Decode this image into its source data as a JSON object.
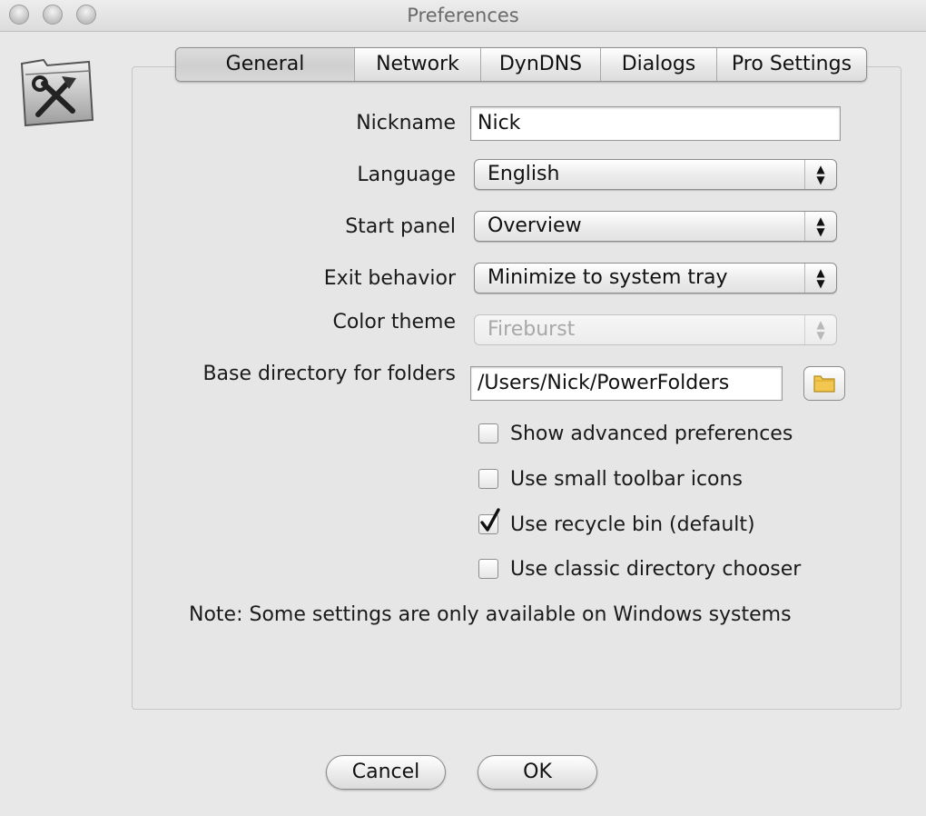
{
  "window": {
    "title": "Preferences"
  },
  "tabs": [
    {
      "label": "General",
      "active": true
    },
    {
      "label": "Network",
      "active": false
    },
    {
      "label": "DynDNS",
      "active": false
    },
    {
      "label": "Dialogs",
      "active": false
    },
    {
      "label": "Pro Settings",
      "active": false
    }
  ],
  "form": {
    "nickname": {
      "label": "Nickname",
      "value": "Nick"
    },
    "language": {
      "label": "Language",
      "value": "English"
    },
    "start_panel": {
      "label": "Start panel",
      "value": "Overview"
    },
    "exit_behavior": {
      "label": "Exit behavior",
      "value": "Minimize to system tray"
    },
    "color_theme": {
      "label": "Color theme",
      "value": "Fireburst",
      "disabled": true
    },
    "base_directory": {
      "label": "Base directory for folders",
      "value": "/Users/Nick/PowerFolders"
    }
  },
  "checkboxes": [
    {
      "label": "Show advanced preferences",
      "checked": false
    },
    {
      "label": "Use small toolbar icons",
      "checked": false
    },
    {
      "label": "Use recycle bin (default)",
      "checked": true
    },
    {
      "label": "Use classic directory chooser",
      "checked": false
    }
  ],
  "note": "Note: Some settings are only available on Windows systems",
  "buttons": {
    "cancel": "Cancel",
    "ok": "OK"
  },
  "icons": {
    "app": "tools-folder-icon",
    "browse": "folder-icon",
    "select_arrows": "up-down-arrows-icon"
  }
}
